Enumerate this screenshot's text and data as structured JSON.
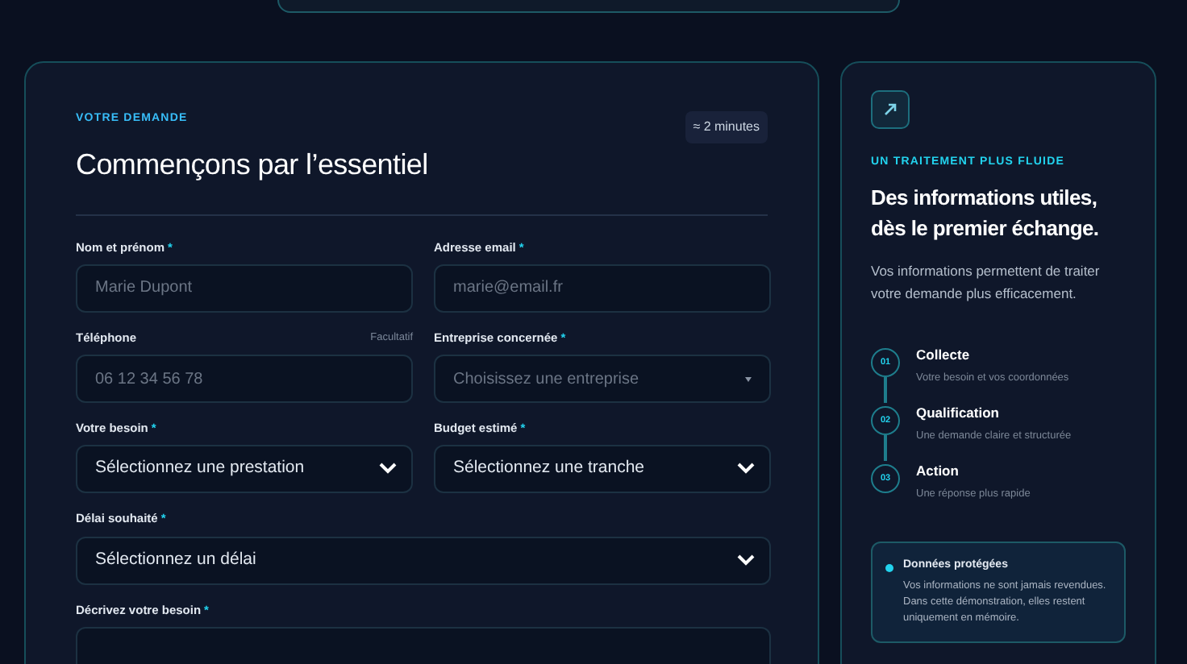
{
  "form": {
    "eyebrow": "VOTRE DEMANDE",
    "title": "Commençons par l’essentiel",
    "duration": "≈ 2 minutes",
    "fields": [
      {
        "kind": "input",
        "label": "Nom et prénom",
        "marker": "*",
        "placeholder": "Marie Dupont",
        "wide": false
      },
      {
        "kind": "input",
        "label": "Adresse email",
        "marker": "*",
        "placeholder": "marie@email.fr",
        "wide": false
      },
      {
        "kind": "input",
        "label": "Téléphone",
        "hint": "Facultatif",
        "placeholder": "06 12 34 56 78",
        "wide": false
      },
      {
        "kind": "combo",
        "label": "Entreprise concernée",
        "marker": "*",
        "placeholder": "Choisissez une entreprise",
        "wide": false
      },
      {
        "kind": "select",
        "label": "Votre besoin",
        "marker": "*",
        "value": "Sélectionnez une prestation",
        "wide": false
      },
      {
        "kind": "select",
        "label": "Budget estimé",
        "marker": "*",
        "value": "Sélectionnez une tranche",
        "wide": false
      },
      {
        "kind": "select",
        "label": "Délai souhaité",
        "marker": "*",
        "value": "Sélectionnez un délai",
        "wide": true
      },
      {
        "kind": "textarea",
        "label": "Décrivez votre besoin",
        "marker": "*",
        "wide": true
      }
    ]
  },
  "side": {
    "eyebrow": "UN TRAITEMENT PLUS FLUIDE",
    "title": "Des informations utiles, dès le premier échange.",
    "text": "Vos informations permettent de traiter votre demande plus efficacement.",
    "steps": [
      {
        "number": "01",
        "title": "Collecte",
        "subtitle": "Votre besoin et vos coordonnées"
      },
      {
        "number": "02",
        "title": "Qualification",
        "subtitle": "Une demande claire et structurée"
      },
      {
        "number": "03",
        "title": "Action",
        "subtitle": "Une réponse plus rapide"
      }
    ],
    "notice": {
      "title": "Données protégées",
      "text": "Vos informations ne sont jamais revendues. Dans cette démonstration, elles restent uniquement en mémoire."
    }
  }
}
